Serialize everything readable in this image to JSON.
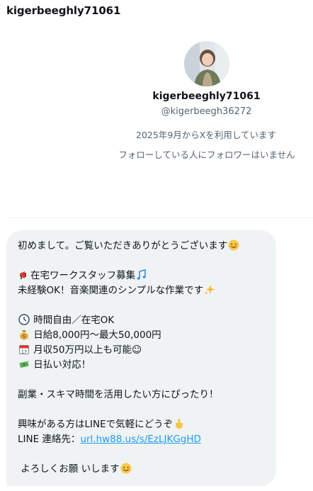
{
  "header": {
    "title": "kigerbeeghly71061"
  },
  "profile": {
    "display_name": "kigerbeeghly71061",
    "handle": "@kigerbeegh36272",
    "joined": "2025年9月からXを利用しています",
    "followers_note": "フォローしている人にフォロワーはいません"
  },
  "message": {
    "line1": "初めまして。ご覧いただきありがとうございます",
    "line2": "在宅ワークスタッフ募集",
    "line3": "未経験OK！音楽関連のシンプルな作業です",
    "line4": "時間自由／在宅OK",
    "line5": "日給8,000円〜最大50,000円",
    "line6": "月収50万円以上も可能☺",
    "line7": "日払い対応！",
    "line8": "副業・スキマ時間を活用したい方にぴったり！",
    "line9": "興味がある方はLINEで気軽にどうぞ",
    "line10_prefix": "LINE 連絡先：",
    "link": "url.hw88.us/s/EzLJKGgHD",
    "line11": "よろしくお願 いします"
  },
  "icons": {
    "smile": "smiling-face-emoji",
    "megaphone": "megaphone-emoji",
    "music": "musical-notes-emoji",
    "sparkles": "sparkles-emoji",
    "clock": "clock-emoji",
    "moneybag": "money-bag-emoji",
    "calendar": "calendar-emoji",
    "money": "money-with-wings-emoji",
    "point": "pointing-down-emoji"
  },
  "colors": {
    "text": "#0f1419",
    "muted": "#536471",
    "bubble": "#eff3f4",
    "link": "#1d9bf0"
  }
}
